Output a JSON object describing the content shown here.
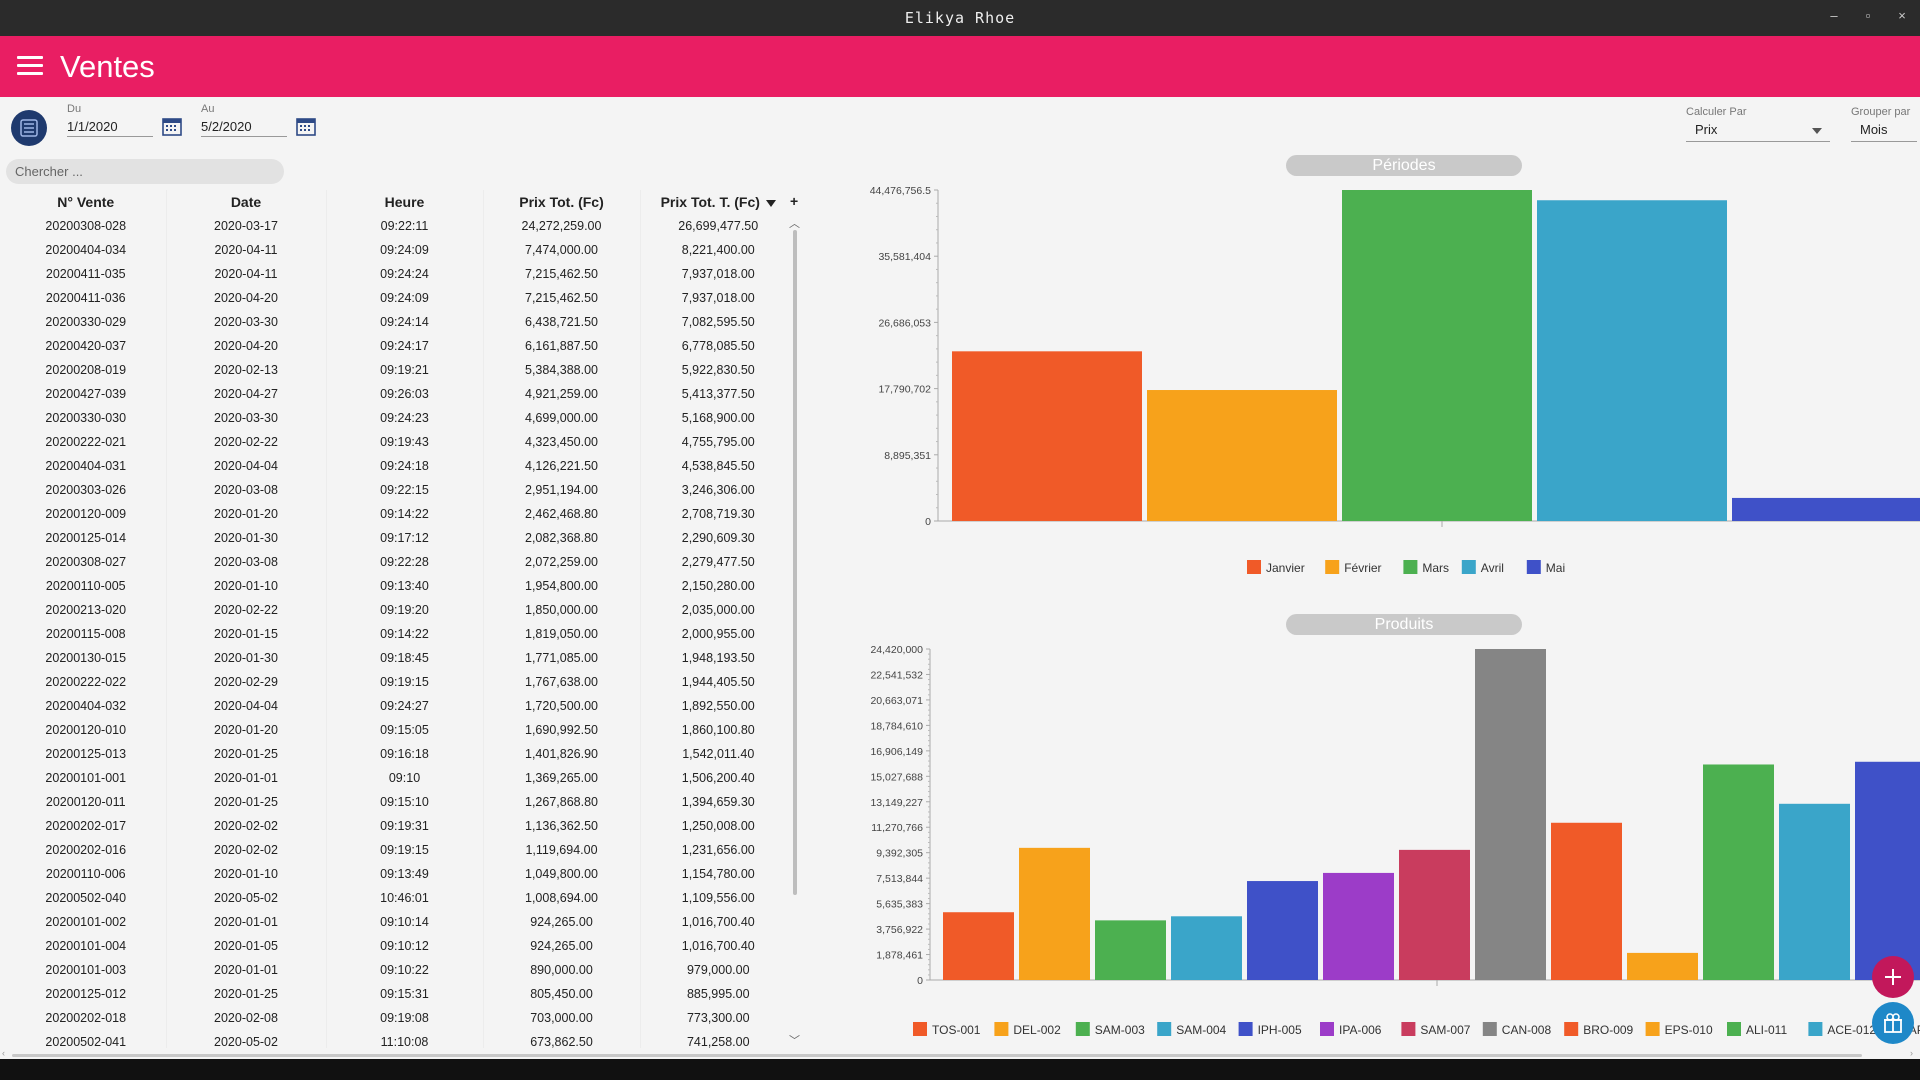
{
  "window": {
    "title": "Elikya Rhoe"
  },
  "appbar": {
    "title": "Ventes"
  },
  "filters": {
    "from_label": "Du",
    "from_value": "1/1/2020",
    "to_label": "Au",
    "to_value": "5/2/2020",
    "calc_label": "Calculer Par",
    "calc_value": "Prix",
    "group_label": "Grouper par",
    "group_value": "Mois"
  },
  "search": {
    "placeholder": "Chercher ..."
  },
  "table": {
    "columns": [
      "N° Vente",
      "Date",
      "Heure",
      "Prix Tot. (Fc)",
      "Prix Tot. T. (Fc)"
    ],
    "add_column_label": "+",
    "rows": [
      [
        "20200308-028",
        "2020-03-17",
        "09:22:11",
        "24,272,259.00",
        "26,699,477.50"
      ],
      [
        "20200404-034",
        "2020-04-11",
        "09:24:09",
        "7,474,000.00",
        "8,221,400.00"
      ],
      [
        "20200411-035",
        "2020-04-11",
        "09:24:24",
        "7,215,462.50",
        "7,937,018.00"
      ],
      [
        "20200411-036",
        "2020-04-20",
        "09:24:09",
        "7,215,462.50",
        "7,937,018.00"
      ],
      [
        "20200330-029",
        "2020-03-30",
        "09:24:14",
        "6,438,721.50",
        "7,082,595.50"
      ],
      [
        "20200420-037",
        "2020-04-20",
        "09:24:17",
        "6,161,887.50",
        "6,778,085.50"
      ],
      [
        "20200208-019",
        "2020-02-13",
        "09:19:21",
        "5,384,388.00",
        "5,922,830.50"
      ],
      [
        "20200427-039",
        "2020-04-27",
        "09:26:03",
        "4,921,259.00",
        "5,413,377.50"
      ],
      [
        "20200330-030",
        "2020-03-30",
        "09:24:23",
        "4,699,000.00",
        "5,168,900.00"
      ],
      [
        "20200222-021",
        "2020-02-22",
        "09:19:43",
        "4,323,450.00",
        "4,755,795.00"
      ],
      [
        "20200404-031",
        "2020-04-04",
        "09:24:18",
        "4,126,221.50",
        "4,538,845.50"
      ],
      [
        "20200303-026",
        "2020-03-08",
        "09:22:15",
        "2,951,194.00",
        "3,246,306.00"
      ],
      [
        "20200120-009",
        "2020-01-20",
        "09:14:22",
        "2,462,468.80",
        "2,708,719.30"
      ],
      [
        "20200125-014",
        "2020-01-30",
        "09:17:12",
        "2,082,368.80",
        "2,290,609.30"
      ],
      [
        "20200308-027",
        "2020-03-08",
        "09:22:28",
        "2,072,259.00",
        "2,279,477.50"
      ],
      [
        "20200110-005",
        "2020-01-10",
        "09:13:40",
        "1,954,800.00",
        "2,150,280.00"
      ],
      [
        "20200213-020",
        "2020-02-22",
        "09:19:20",
        "1,850,000.00",
        "2,035,000.00"
      ],
      [
        "20200115-008",
        "2020-01-15",
        "09:14:22",
        "1,819,050.00",
        "2,000,955.00"
      ],
      [
        "20200130-015",
        "2020-01-30",
        "09:18:45",
        "1,771,085.00",
        "1,948,193.50"
      ],
      [
        "20200222-022",
        "2020-02-29",
        "09:19:15",
        "1,767,638.00",
        "1,944,405.50"
      ],
      [
        "20200404-032",
        "2020-04-04",
        "09:24:27",
        "1,720,500.00",
        "1,892,550.00"
      ],
      [
        "20200120-010",
        "2020-01-20",
        "09:15:05",
        "1,690,992.50",
        "1,860,100.80"
      ],
      [
        "20200125-013",
        "2020-01-25",
        "09:16:18",
        "1,401,826.90",
        "1,542,011.40"
      ],
      [
        "20200101-001",
        "2020-01-01",
        "09:10",
        "1,369,265.00",
        "1,506,200.40"
      ],
      [
        "20200120-011",
        "2020-01-25",
        "09:15:10",
        "1,267,868.80",
        "1,394,659.30"
      ],
      [
        "20200202-017",
        "2020-02-02",
        "09:19:31",
        "1,136,362.50",
        "1,250,008.00"
      ],
      [
        "20200202-016",
        "2020-02-02",
        "09:19:15",
        "1,119,694.00",
        "1,231,656.00"
      ],
      [
        "20200110-006",
        "2020-01-10",
        "09:13:49",
        "1,049,800.00",
        "1,154,780.00"
      ],
      [
        "20200502-040",
        "2020-05-02",
        "10:46:01",
        "1,008,694.00",
        "1,109,556.00"
      ],
      [
        "20200101-002",
        "2020-01-01",
        "09:10:14",
        "924,265.00",
        "1,016,700.40"
      ],
      [
        "20200101-004",
        "2020-01-05",
        "09:10:12",
        "924,265.00",
        "1,016,700.40"
      ],
      [
        "20200101-003",
        "2020-01-01",
        "09:10:22",
        "890,000.00",
        "979,000.00"
      ],
      [
        "20200125-012",
        "2020-01-25",
        "09:15:31",
        "805,450.00",
        "885,995.00"
      ],
      [
        "20200202-018",
        "2020-02-08",
        "09:19:08",
        "703,000.00",
        "773,300.00"
      ],
      [
        "20200502-041",
        "2020-05-02",
        "11:10:08",
        "673,862.50",
        "741,258.00"
      ]
    ]
  },
  "chart_data": [
    {
      "type": "bar",
      "title": "Périodes",
      "categories": [
        "Janvier",
        "Février",
        "Mars",
        "Avril",
        "Mai"
      ],
      "values": [
        22800000,
        17600000,
        44476756.5,
        43100000,
        3100000
      ],
      "colors": [
        "#f05a28",
        "#f7a21b",
        "#4cb050",
        "#3aa5c9",
        "#3f51c8"
      ],
      "yticks": [
        "0",
        "8,895,351",
        "17,790,702",
        "26,686,053",
        "35,581,404",
        "44,476,756.5"
      ],
      "ylim": [
        0,
        44476756.5
      ],
      "legend": "bottom"
    },
    {
      "type": "bar",
      "title": "Produits",
      "categories": [
        "TOS-001",
        "DEL-002",
        "SAM-003",
        "SAM-004",
        "IPH-005",
        "IPA-006",
        "SAM-007",
        "CAN-008",
        "BRO-009",
        "EPS-010",
        "ALI-011",
        "ACE-012",
        "APP-"
      ],
      "values": [
        5000000,
        9750000,
        4400000,
        4700000,
        7300000,
        7900000,
        9600000,
        24420000,
        11600000,
        2000000,
        15900000,
        13000000,
        16100000
      ],
      "colors": [
        "#f05a28",
        "#f7a21b",
        "#4cb050",
        "#3aa5c9",
        "#3f51c8",
        "#9c3cc8",
        "#c93c5e",
        "#858585",
        "#f05a28",
        "#f7a21b",
        "#4cb050",
        "#3aa5c9",
        "#3f51c8"
      ],
      "yticks": [
        "0",
        "1,878,461",
        "3,756,922",
        "5,635,383",
        "7,513,844",
        "9,392,305",
        "11,270,766",
        "13,149,227",
        "15,027,688",
        "16,906,149",
        "18,784,610",
        "20,663,071",
        "22,541,532",
        "24,420,000"
      ],
      "ylim": [
        0,
        24420000
      ],
      "legend": "bottom"
    }
  ],
  "icons": {
    "fab_add": "plus-icon",
    "fab_gift": "gift-icon",
    "list_btn": "list-icon",
    "calendar": "calendar-icon"
  },
  "colors": {
    "accent": "#e91e63",
    "fab_add": "#c2185b",
    "fab_second": "#1e88c8"
  }
}
